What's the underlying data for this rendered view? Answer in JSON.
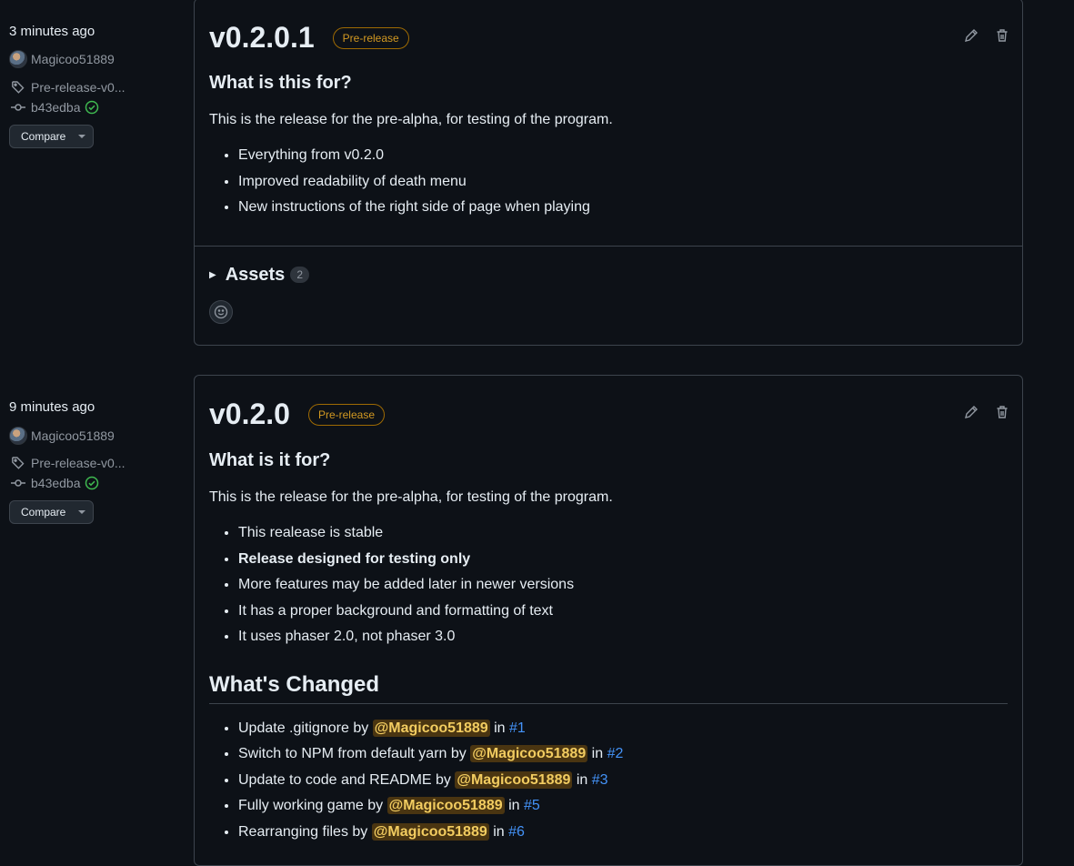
{
  "releases": [
    {
      "time": "3 minutes ago",
      "author": "Magicoo51889",
      "tag": "Pre-release-v0...",
      "commit": "b43edba",
      "compare_label": "Compare",
      "version": "v0.2.0.1",
      "badge": "Pre-release",
      "heading": "What is this for?",
      "description": "This is the release for the pre-alpha, for testing of the program.",
      "items": [
        "Everything from v0.2.0",
        "Improved readability of death menu",
        "New instructions of the right side of page when playing"
      ],
      "assets_label": "Assets",
      "assets_count": "2"
    },
    {
      "time": "9 minutes ago",
      "author": "Magicoo51889",
      "tag": "Pre-release-v0...",
      "commit": "b43edba",
      "compare_label": "Compare",
      "version": "v0.2.0",
      "badge": "Pre-release",
      "heading": "What is it for?",
      "description": "This is the release for the pre-alpha, for testing of the program.",
      "items": [
        "This realease is stable",
        "Release designed for testing only",
        "More features may be added later in newer versions",
        "It has a proper background and formatting of text",
        "It uses phaser 2.0, not phaser 3.0"
      ],
      "changes_heading": "What's Changed",
      "by_word": "by",
      "in_word": "in",
      "changes": [
        {
          "text": "Update .gitignore",
          "mention": "@Magicoo51889",
          "pr": "#1"
        },
        {
          "text": "Switch to NPM from default yarn",
          "mention": "@Magicoo51889",
          "pr": "#2"
        },
        {
          "text": "Update to code and README",
          "mention": "@Magicoo51889",
          "pr": "#3"
        },
        {
          "text": "Fully working game",
          "mention": "@Magicoo51889",
          "pr": "#5"
        },
        {
          "text": "Rearranging files",
          "mention": "@Magicoo51889",
          "pr": "#6"
        }
      ]
    }
  ]
}
